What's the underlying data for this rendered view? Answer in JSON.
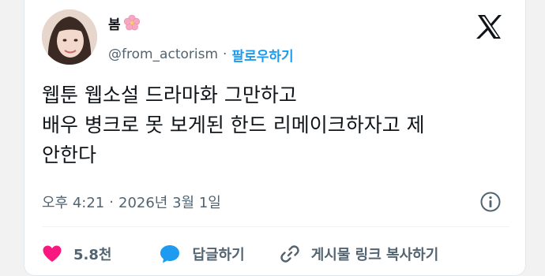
{
  "user": {
    "display_name": "봄",
    "handle": "@from_actorism",
    "follow_label": "팔로우하기",
    "separator": "·"
  },
  "tweet": {
    "lines": [
      "웹툰 웹소설 드라마화 그만하고",
      "배우 병크로 못 보게된 한드 리메이크하자고 제",
      "안한다"
    ]
  },
  "meta": {
    "time": "오후 4:21",
    "separator": "·",
    "date": "2026년 3월 1일"
  },
  "actions": {
    "like_count": "5.8천",
    "reply_label": "답글하기",
    "copy_link_label": "게시물 링크 복사하기"
  },
  "icons": {
    "emoji": "cherry-blossom-icon",
    "logo": "x-logo-icon",
    "info": "info-icon",
    "like": "heart-icon",
    "reply": "speech-bubble-icon",
    "copy": "link-icon"
  },
  "colors": {
    "accent": "#1d9bf0",
    "heart": "#f91880",
    "text": "#0f1419",
    "muted": "#536471"
  }
}
